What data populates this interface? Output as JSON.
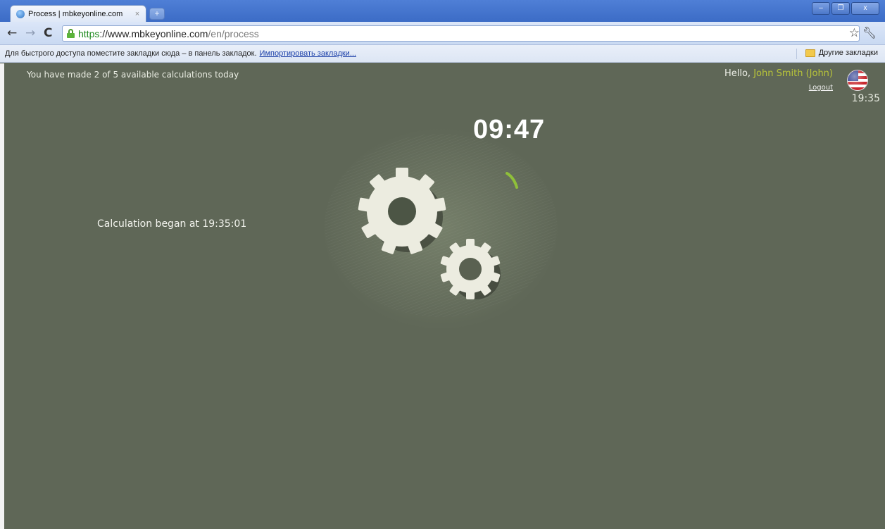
{
  "browser": {
    "tab_title": "Process | mbkeyonline.com",
    "tab_close": "×",
    "new_tab": "+",
    "url_scheme": "https",
    "url_host": "://www.mbkeyonline.com",
    "url_path": "/en/process",
    "bookmarks_hint": "Для быстрого доступа поместите закладки сюда – в панель закладок.",
    "bookmarks_import": "Импортировать закладки...",
    "bookmarks_other": "Другие закладки"
  },
  "header": {
    "calc_count": "You have made 2 of 5 available calculations today",
    "hello_prefix": "Hello, ",
    "user_name": "John Smith (John)",
    "logout": "Logout",
    "clock": "19:35"
  },
  "main": {
    "began": "Calculation began at 19:35:01",
    "timer": "09:47"
  },
  "colors": {
    "page_bg": "#5f6757",
    "user_accent": "#b8c43a",
    "gear": "#ecece0"
  }
}
